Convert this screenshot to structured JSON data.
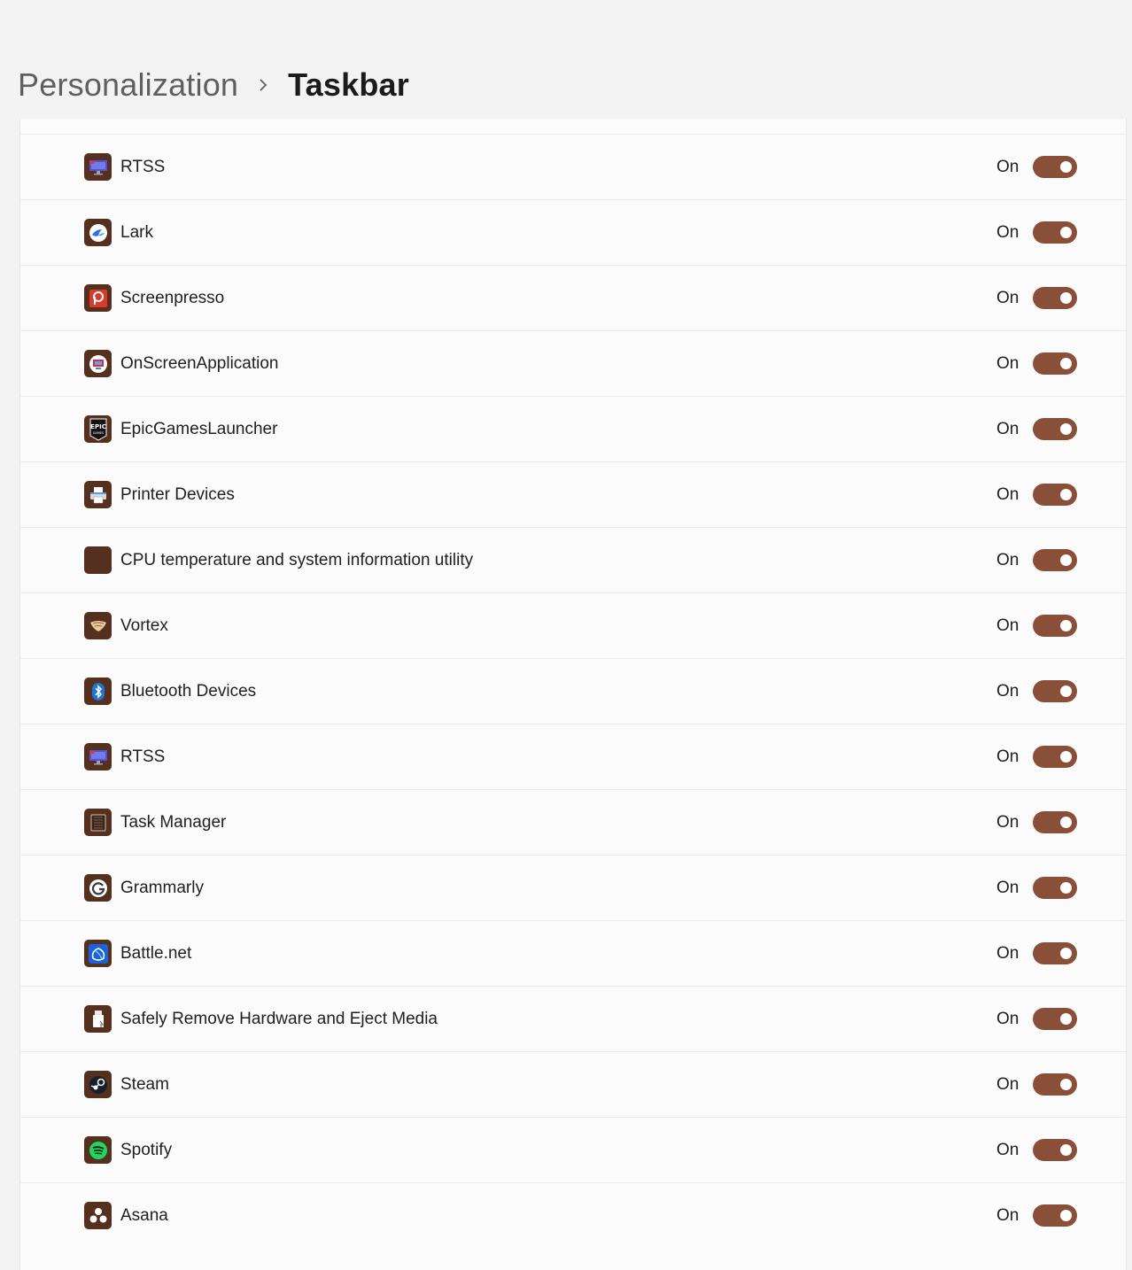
{
  "breadcrumb": {
    "parent": "Personalization",
    "separator_icon": "chevron-right-icon",
    "current": "Taskbar"
  },
  "theme": {
    "accent": "#8a4f38",
    "icon_tile": "#55301e",
    "page_bg": "#f3f3f3",
    "panel_bg": "#fbfbfb"
  },
  "items": [
    {
      "name": "RTSS",
      "state": "On",
      "enabled": true,
      "icon": "rtss-monitor-icon"
    },
    {
      "name": "Lark",
      "state": "On",
      "enabled": true,
      "icon": "lark-bird-icon"
    },
    {
      "name": "Screenpresso",
      "state": "On",
      "enabled": true,
      "icon": "screenpresso-icon"
    },
    {
      "name": "OnScreenApplication",
      "state": "On",
      "enabled": true,
      "icon": "onscreen-display-icon"
    },
    {
      "name": "EpicGamesLauncher",
      "state": "On",
      "enabled": true,
      "icon": "epic-games-icon"
    },
    {
      "name": "Printer Devices",
      "state": "On",
      "enabled": true,
      "icon": "printer-icon"
    },
    {
      "name": "CPU temperature and system information utility",
      "state": "On",
      "enabled": true,
      "icon": "blank-app-icon"
    },
    {
      "name": "Vortex",
      "state": "On",
      "enabled": true,
      "icon": "vortex-icon"
    },
    {
      "name": "Bluetooth Devices",
      "state": "On",
      "enabled": true,
      "icon": "bluetooth-icon"
    },
    {
      "name": "RTSS",
      "state": "On",
      "enabled": true,
      "icon": "rtss-monitor-icon"
    },
    {
      "name": "Task Manager",
      "state": "On",
      "enabled": true,
      "icon": "task-manager-icon"
    },
    {
      "name": "Grammarly",
      "state": "On",
      "enabled": true,
      "icon": "grammarly-icon"
    },
    {
      "name": "Battle.net",
      "state": "On",
      "enabled": true,
      "icon": "battlenet-icon"
    },
    {
      "name": "Safely Remove Hardware and Eject Media",
      "state": "On",
      "enabled": true,
      "icon": "usb-eject-icon"
    },
    {
      "name": "Steam",
      "state": "On",
      "enabled": true,
      "icon": "steam-icon"
    },
    {
      "name": "Spotify",
      "state": "On",
      "enabled": true,
      "icon": "spotify-icon"
    },
    {
      "name": "Asana",
      "state": "On",
      "enabled": true,
      "icon": "asana-icon"
    }
  ]
}
